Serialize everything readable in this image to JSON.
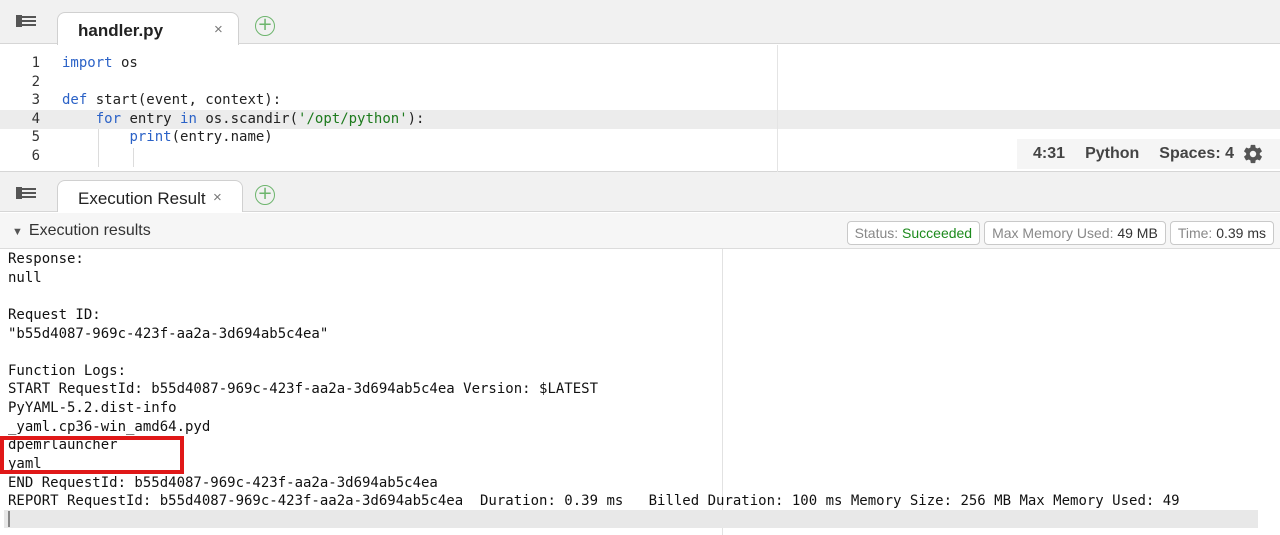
{
  "editor": {
    "tab_label": "handler.py",
    "tab_close": "×",
    "add_tab": "+",
    "line_numbers": [
      "1",
      "2",
      "3",
      "4",
      "5",
      "6"
    ],
    "code_lines": [
      [
        {
          "t": "import",
          "c": "kw"
        },
        {
          "t": " os",
          "c": ""
        }
      ],
      [],
      [
        {
          "t": "def",
          "c": "kw"
        },
        {
          "t": " start(event, context):",
          "c": ""
        }
      ],
      [
        {
          "t": "    ",
          "c": ""
        },
        {
          "t": "for",
          "c": "kw"
        },
        {
          "t": " entry ",
          "c": ""
        },
        {
          "t": "in",
          "c": "kw"
        },
        {
          "t": " os.scandir(",
          "c": ""
        },
        {
          "t": "'/opt/python'",
          "c": "str"
        },
        {
          "t": "):",
          "c": ""
        }
      ],
      [
        {
          "t": "        ",
          "c": ""
        },
        {
          "t": "print",
          "c": "fn"
        },
        {
          "t": "(entry.name)",
          "c": ""
        }
      ],
      []
    ],
    "cursor_position": "4:31",
    "language": "Python",
    "spaces": "Spaces: 4",
    "settings_icon": "gear-icon"
  },
  "results_panel": {
    "tab_label": "Execution Result",
    "tab_close": "×",
    "add_tab": "+",
    "section_title": "Execution results",
    "status_label": "Status: ",
    "status_value": "Succeeded",
    "memory_label": "Max Memory Used: ",
    "memory_value": "49 MB",
    "time_label": "Time: ",
    "time_value": "0.39 ms",
    "output_lines": [
      "Response:",
      "null",
      "",
      "Request ID:",
      "\"b55d4087-969c-423f-aa2a-3d694ab5c4ea\"",
      "",
      "Function Logs:",
      "START RequestId: b55d4087-969c-423f-aa2a-3d694ab5c4ea Version: $LATEST",
      "PyYAML-5.2.dist-info",
      "_yaml.cp36-win_amd64.pyd",
      "dpemrlauncher",
      "yaml",
      "END RequestId: b55d4087-969c-423f-aa2a-3d694ab5c4ea",
      "REPORT RequestId: b55d4087-969c-423f-aa2a-3d694ab5c4ea  Duration: 0.39 ms   Billed Duration: 100 ms Memory Size: 256 MB Max Memory Used: 49"
    ]
  },
  "colors": {
    "keyword": "#2b62c7",
    "string": "#1d7a1d",
    "success": "#1d8a1d",
    "highlight_box": "#e01818"
  }
}
